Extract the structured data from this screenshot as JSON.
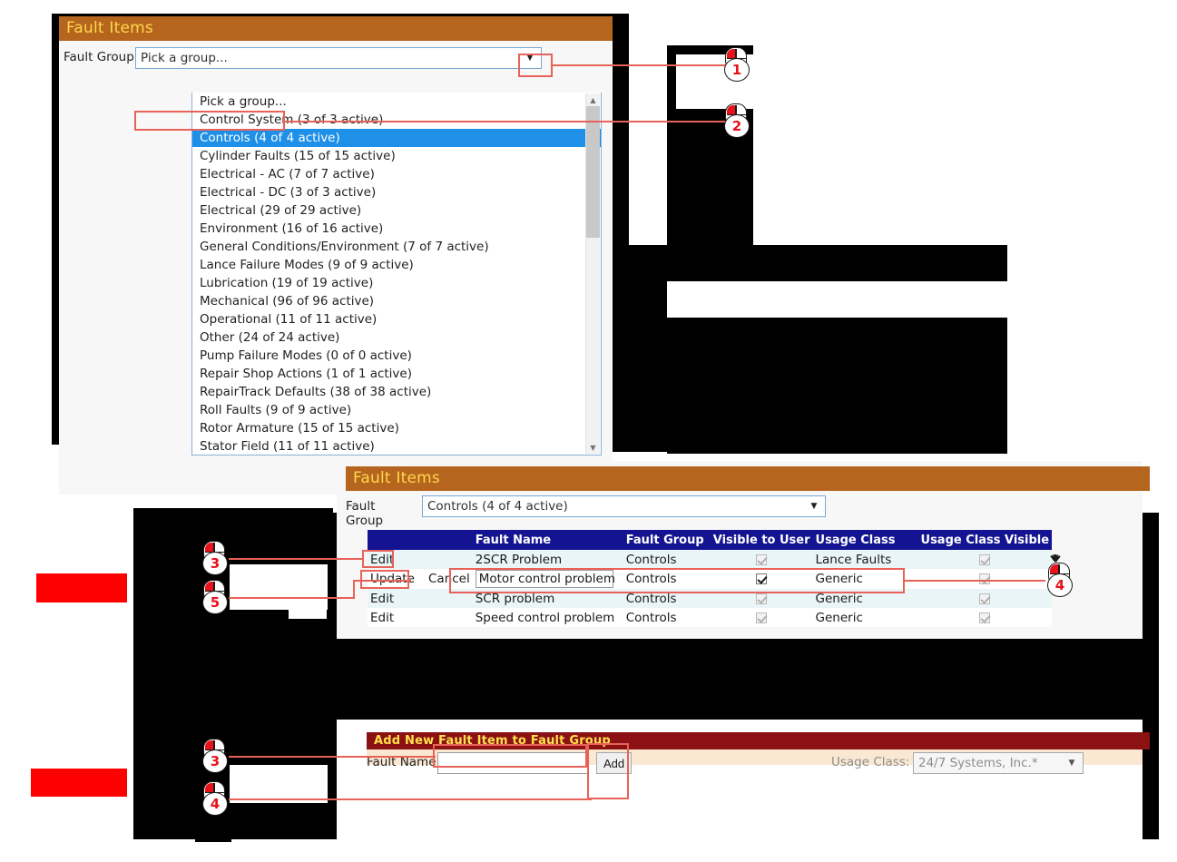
{
  "panel1": {
    "title": "Fault Items",
    "fault_group_label": "Fault Group",
    "selected_value": "Pick a group...",
    "dropdown_open": true,
    "options": [
      "Pick a group...",
      "Control System (3 of 3 active)",
      "Controls (4 of 4 active)",
      "Cylinder Faults (15 of 15 active)",
      "Electrical - AC (7 of 7 active)",
      "Electrical - DC (3 of 3 active)",
      "Electrical (29 of 29 active)",
      "Environment (16 of 16 active)",
      "General Conditions/Environment (7 of 7 active)",
      "Lance Failure Modes (9 of 9 active)",
      "Lubrication (19 of 19 active)",
      "Mechanical (96 of 96 active)",
      "Operational (11 of 11 active)",
      "Other (24 of 24 active)",
      "Pump Failure Modes (0 of 0 active)",
      "Repair Shop Actions (1 of 1 active)",
      "RepairTrack Defaults (38 of 38 active)",
      "Roll Faults (9 of 9 active)",
      "Rotor Armature (15 of 15 active)",
      "Stator Field (11 of 11 active)"
    ],
    "highlighted_option": "Controls (4 of 4 active)",
    "scroll_up_glyph": "▲",
    "scroll_down_glyph": "▼",
    "arrow_glyph": "▼"
  },
  "panel2": {
    "title": "Fault Items",
    "fault_group_label": "Fault Group",
    "selected_value": "Controls (4 of 4 active)",
    "arrow_glyph": "▼",
    "columns": [
      "",
      "",
      "Fault Name",
      "Fault Group",
      "Visible to User",
      "Usage Class",
      "Usage Class Visible"
    ],
    "rows": [
      {
        "mode": "view",
        "action": "Edit",
        "action2": "",
        "fault_name": "2SCR Problem",
        "fault_group": "Controls",
        "visible_to_user": true,
        "usage_class": "Lance Faults",
        "usage_class_visible": true
      },
      {
        "mode": "edit",
        "action": "Update",
        "action2": "Cancel",
        "fault_name": "Motor control problem",
        "fault_group": "Controls",
        "visible_to_user": true,
        "usage_class": "Generic",
        "usage_class_visible": true
      },
      {
        "mode": "view",
        "action": "Edit",
        "action2": "",
        "fault_name": "SCR problem",
        "fault_group": "Controls",
        "visible_to_user": true,
        "usage_class": "Generic",
        "usage_class_visible": true
      },
      {
        "mode": "view",
        "action": "Edit",
        "action2": "",
        "fault_name": "Speed control problem",
        "fault_group": "Controls",
        "visible_to_user": true,
        "usage_class": "Generic",
        "usage_class_visible": true
      }
    ]
  },
  "panel3": {
    "title": "Add New Fault Item to Fault Group",
    "fault_name_label": "Fault Name",
    "fault_name_value": "",
    "fault_name_placeholder": "",
    "add_button": "Add",
    "usage_class_label": "Usage Class:",
    "usage_class_value": "24/7 Systems, Inc.*",
    "arrow_glyph": "▼"
  },
  "callouts": [
    {
      "id": "c1",
      "number": "1",
      "clicked": false
    },
    {
      "id": "c2",
      "number": "2",
      "clicked": false
    },
    {
      "id": "c3a",
      "number": "3",
      "clicked": false
    },
    {
      "id": "c5",
      "number": "5",
      "clicked": false
    },
    {
      "id": "c4",
      "number": "4",
      "clicked": true
    },
    {
      "id": "c3b",
      "number": "3",
      "clicked": false
    },
    {
      "id": "c4b",
      "number": "4",
      "clicked": false
    }
  ],
  "colors": {
    "header_orange": "#b5651d",
    "header_darkred": "#8b1113",
    "header_text_yellow": "#ffd84d",
    "table_header_navy": "#141493",
    "selection_blue": "#1e90e8",
    "callout_red": "#e8625a",
    "redaction_black": "#000000",
    "redaction_red": "#ff0000",
    "panel_bg": "#f7f7f7",
    "band_peach": "#fae8d2"
  }
}
